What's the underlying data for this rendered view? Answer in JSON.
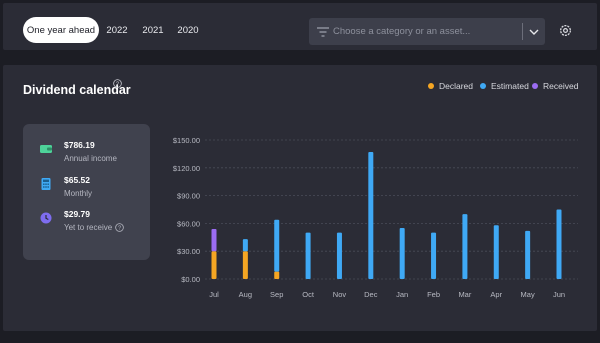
{
  "tabs": [
    {
      "label": "One year ahead",
      "active": true
    },
    {
      "label": "2022",
      "active": false
    },
    {
      "label": "2021",
      "active": false
    },
    {
      "label": "2020",
      "active": false
    }
  ],
  "search": {
    "placeholder": "Choose a category or an asset..."
  },
  "icons": {
    "filter": "filter-icon",
    "chevron": "chevron-down-icon",
    "settings": "gear-icon"
  },
  "panel": {
    "title": "Dividend calendar",
    "legend": [
      {
        "label": "Declared",
        "color": "#f5a623"
      },
      {
        "label": "Estimated",
        "color": "#3fa9f5"
      },
      {
        "label": "Received",
        "color": "#9b6cf2"
      }
    ]
  },
  "stats": [
    {
      "value": "$786.19",
      "label": "Annual income",
      "icon": "wallet-icon",
      "color": "#4ed39a"
    },
    {
      "value": "$65.52",
      "label": "Monthly",
      "icon": "calculator-icon",
      "color": "#3fa9f5"
    },
    {
      "value": "$29.79",
      "label": "Yet to receive",
      "icon": "clock-icon",
      "color": "#7e6df0"
    }
  ],
  "chart_data": {
    "type": "bar",
    "stacked": true,
    "categories": [
      "Jul",
      "Aug",
      "Sep",
      "Oct",
      "Nov",
      "Dec",
      "Jan",
      "Feb",
      "Mar",
      "Apr",
      "May",
      "Jun"
    ],
    "y_ticks": [
      "$0.00",
      "$30.00",
      "$60.00",
      "$90.00",
      "$120.00",
      "$150.00"
    ],
    "ylim": [
      0,
      150
    ],
    "grid": true,
    "legend_position": "top-right",
    "series": [
      {
        "name": "Declared",
        "color": "#f5a623",
        "values": [
          30,
          30,
          8,
          0,
          0,
          0,
          0,
          0,
          0,
          0,
          0,
          0
        ]
      },
      {
        "name": "Estimated",
        "color": "#3fa9f5",
        "values": [
          0,
          13,
          56,
          50,
          50,
          137,
          55,
          50,
          70,
          58,
          52,
          75
        ]
      },
      {
        "name": "Received",
        "color": "#9b6cf2",
        "values": [
          24,
          0,
          0,
          0,
          0,
          0,
          0,
          0,
          0,
          0,
          0,
          0
        ]
      }
    ]
  }
}
